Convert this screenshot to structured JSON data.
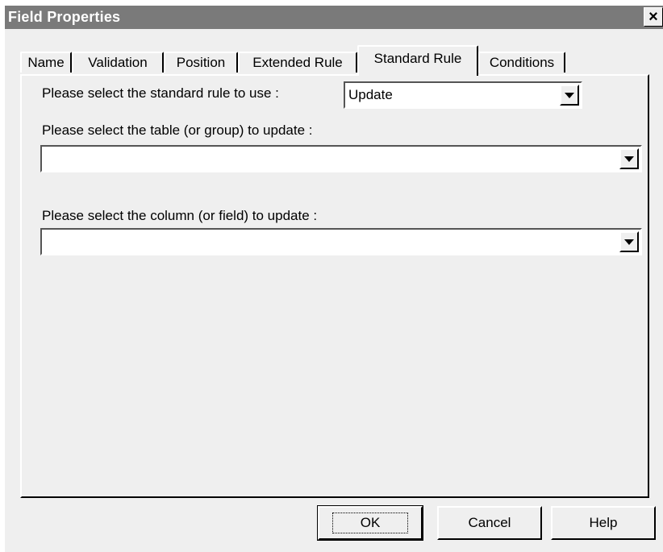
{
  "window": {
    "title": "Field Properties",
    "close_icon": "×"
  },
  "tabs": [
    {
      "label": "Name",
      "active": false
    },
    {
      "label": "Validation",
      "active": false
    },
    {
      "label": "Position",
      "active": false
    },
    {
      "label": "Extended Rule",
      "active": false
    },
    {
      "label": "Standard Rule",
      "active": true
    },
    {
      "label": "Conditions",
      "active": false
    }
  ],
  "standard_rule": {
    "rule_label": "Please select the standard rule to use :",
    "rule_value": "Update",
    "table_label": "Please select the table (or group) to update :",
    "table_value": "",
    "column_label": "Please select the column (or field) to update :",
    "column_value": ""
  },
  "buttons": {
    "ok": "OK",
    "cancel": "Cancel",
    "help": "Help"
  },
  "colors": {
    "titlebar": "#7a7a7a",
    "face": "#efefef"
  }
}
